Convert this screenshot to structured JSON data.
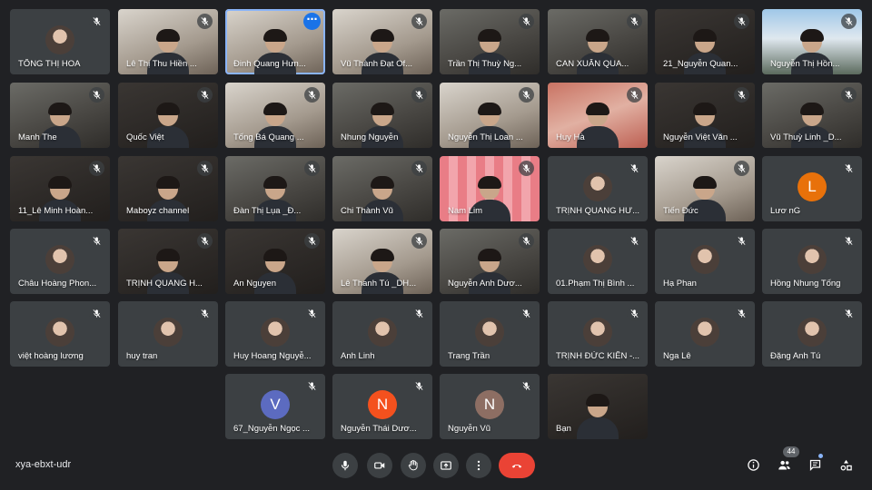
{
  "meeting": {
    "code": "xya-ebxt-udr",
    "people_count": "44"
  },
  "participants": [
    {
      "name": "TỐNG THỊ HOA",
      "kind": "avatar",
      "style": "photo"
    },
    {
      "name": "Lê Thị Thu Hiền ...",
      "kind": "video",
      "style": "light"
    },
    {
      "name": "Đinh Quang Hưn...",
      "kind": "video",
      "style": "light",
      "speaking": true,
      "more": true
    },
    {
      "name": "Vũ Thành Đạt Of...",
      "kind": "video",
      "style": "light"
    },
    {
      "name": "Trần Thị Thuỳ Ng...",
      "kind": "video",
      "style": "video"
    },
    {
      "name": "CAN XUÂN QUA...",
      "kind": "video",
      "style": "video"
    },
    {
      "name": "21_Nguyễn Quan...",
      "kind": "video",
      "style": "dark"
    },
    {
      "name": "Nguyễn Thị Hồn...",
      "kind": "video",
      "style": "mountains"
    },
    {
      "name": "Manh The",
      "kind": "video",
      "style": "video"
    },
    {
      "name": "Quốc Việt",
      "kind": "video",
      "style": "dark"
    },
    {
      "name": "Tống Bá Quang ...",
      "kind": "video",
      "style": "light"
    },
    {
      "name": "Nhung Nguyễn",
      "kind": "video",
      "style": "video"
    },
    {
      "name": "Nguyễn Thị Loan ...",
      "kind": "video",
      "style": "light"
    },
    {
      "name": "Huy Hà",
      "kind": "video",
      "style": "flowers"
    },
    {
      "name": "Nguyễn Việt Văn ...",
      "kind": "video",
      "style": "dark"
    },
    {
      "name": "Vũ Thuỳ Linh _D...",
      "kind": "video",
      "style": "video"
    },
    {
      "name": "11_Lê Minh Hoàn...",
      "kind": "video",
      "style": "dark"
    },
    {
      "name": "Maboyz channel",
      "kind": "video",
      "style": "dark"
    },
    {
      "name": "Đàn Thị Lụa _Đ...",
      "kind": "video",
      "style": "video"
    },
    {
      "name": "Chi Thành Vũ",
      "kind": "video",
      "style": "video"
    },
    {
      "name": "Nam Lim",
      "kind": "video",
      "style": "pink"
    },
    {
      "name": "TRỊNH QUANG HƯ...",
      "kind": "avatar",
      "style": "photo"
    },
    {
      "name": "Tiến Đức",
      "kind": "video",
      "style": "light"
    },
    {
      "name": "Lươ nG",
      "kind": "avatar",
      "style": "letter-orange",
      "letter": "L"
    },
    {
      "name": "Châu Hoàng Phon...",
      "kind": "avatar",
      "style": "photo"
    },
    {
      "name": "TRỊNH QUANG H...",
      "kind": "video",
      "style": "dark"
    },
    {
      "name": "An Nguyen",
      "kind": "video",
      "style": "dark"
    },
    {
      "name": "Lê Thanh Tú _DH...",
      "kind": "video",
      "style": "light"
    },
    {
      "name": "Nguyễn Anh Dươ...",
      "kind": "video",
      "style": "video"
    },
    {
      "name": "01.Phạm Thị Bình ...",
      "kind": "avatar",
      "style": "photo"
    },
    {
      "name": "Hạ Phan",
      "kind": "avatar",
      "style": "photo"
    },
    {
      "name": "Hồng Nhung Tống",
      "kind": "avatar",
      "style": "photo"
    },
    {
      "name": "việt hoàng lương",
      "kind": "avatar",
      "style": "photo"
    },
    {
      "name": "huy tran",
      "kind": "avatar",
      "style": "photo"
    },
    {
      "name": "Huy Hoang Nguyễ...",
      "kind": "avatar",
      "style": "photo"
    },
    {
      "name": "Anh Linh",
      "kind": "avatar",
      "style": "photo"
    },
    {
      "name": "Trang Trần",
      "kind": "avatar",
      "style": "photo"
    },
    {
      "name": "TRỊNH ĐỨC KIÊN -...",
      "kind": "avatar",
      "style": "photo"
    },
    {
      "name": "Nga Lê",
      "kind": "avatar",
      "style": "photo"
    },
    {
      "name": "Đặng Anh Tú",
      "kind": "avatar",
      "style": "photo"
    },
    {
      "name": "67_Nguyễn Ngọc ...",
      "kind": "avatar",
      "style": "letter-purple",
      "letter": "V"
    },
    {
      "name": "Nguyễn Thái Dươ...",
      "kind": "avatar",
      "style": "letter-red",
      "letter": "N"
    },
    {
      "name": "Nguyễn Vũ",
      "kind": "avatar",
      "style": "letter-brown",
      "letter": "N"
    },
    {
      "name": "Bạn",
      "kind": "video",
      "style": "dark",
      "self": true
    }
  ],
  "controls": {
    "center": [
      "microphone-icon",
      "camera-icon",
      "raise-hand-icon",
      "present-screen-icon",
      "more-options-icon",
      "hang-up-icon"
    ],
    "right": [
      "info-icon",
      "people-icon",
      "chat-icon",
      "activities-icon"
    ]
  }
}
